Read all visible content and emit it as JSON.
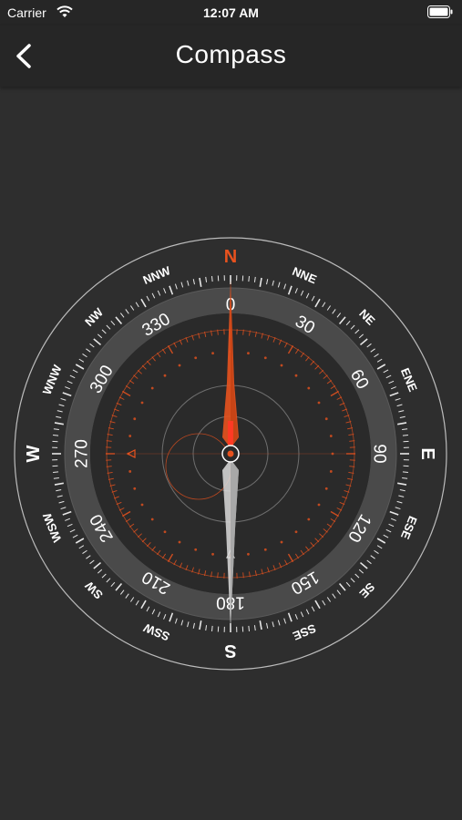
{
  "status_bar": {
    "carrier": "Carrier",
    "time": "12:07 AM",
    "wifi_icon": "wifi-icon",
    "battery_icon": "battery-icon"
  },
  "nav": {
    "title": "Compass",
    "back_icon": "chevron-left-icon"
  },
  "compass": {
    "directions": [
      {
        "label": "N",
        "bearing": 0,
        "highlight": true
      },
      {
        "label": "NNE",
        "bearing": 22.5
      },
      {
        "label": "NE",
        "bearing": 45
      },
      {
        "label": "ENE",
        "bearing": 67.5
      },
      {
        "label": "E",
        "bearing": 90
      },
      {
        "label": "ESE",
        "bearing": 112.5
      },
      {
        "label": "SE",
        "bearing": 135
      },
      {
        "label": "SSE",
        "bearing": 157.5
      },
      {
        "label": "S",
        "bearing": 180
      },
      {
        "label": "SSW",
        "bearing": 202.5
      },
      {
        "label": "SW",
        "bearing": 225
      },
      {
        "label": "WSW",
        "bearing": 247.5
      },
      {
        "label": "W",
        "bearing": 270
      },
      {
        "label": "WNW",
        "bearing": 292.5
      },
      {
        "label": "NW",
        "bearing": 315
      },
      {
        "label": "NNW",
        "bearing": 337.5
      }
    ],
    "degree_labels": [
      "0",
      "30",
      "60",
      "90",
      "120",
      "150",
      "180",
      "210",
      "240",
      "270",
      "300",
      "330"
    ],
    "heading_degrees": 0,
    "colors": {
      "accent": "#e8521e",
      "needle_north": "#e8521e",
      "needle_south": "#d9d9d9",
      "ring": "#4a4a4a",
      "background": "#2e2e2e"
    }
  }
}
